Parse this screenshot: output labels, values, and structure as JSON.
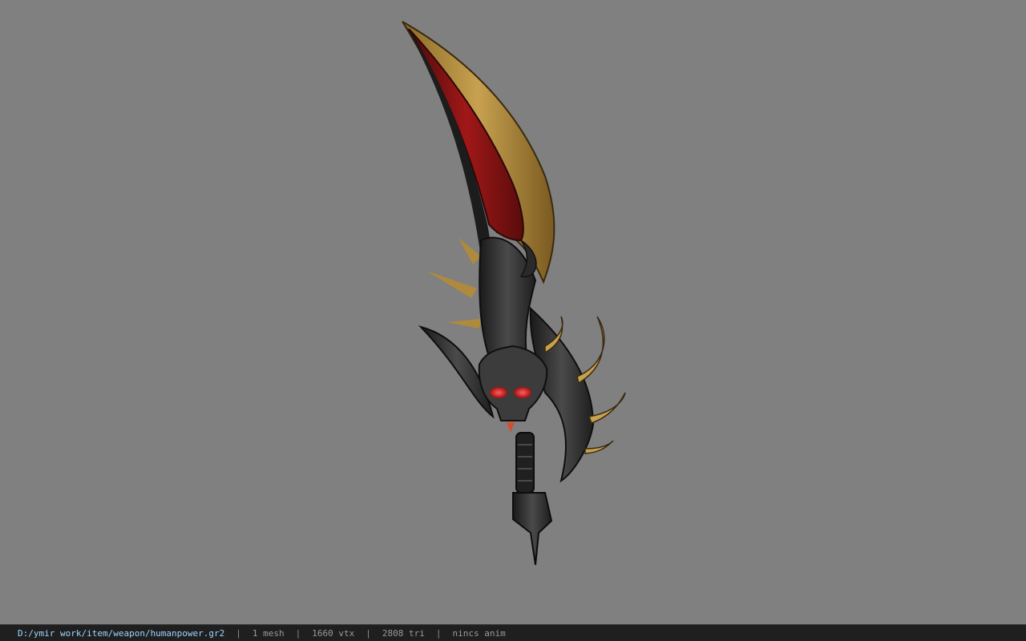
{
  "status": {
    "file_path": "D:/ymir work/item/weapon/humanpower.gr2",
    "separator": "|",
    "mesh_count": "1 mesh",
    "vertex_count": "1660 vtx",
    "triangle_count": "2808 tri",
    "animation": "nincs anim"
  },
  "colors": {
    "viewport_bg": "#808080",
    "status_bg": "#1f1f1f",
    "path_text": "#9fd4ff",
    "stat_text": "#9a9a9a"
  },
  "model": {
    "icon": "scimitar-sword-model"
  }
}
